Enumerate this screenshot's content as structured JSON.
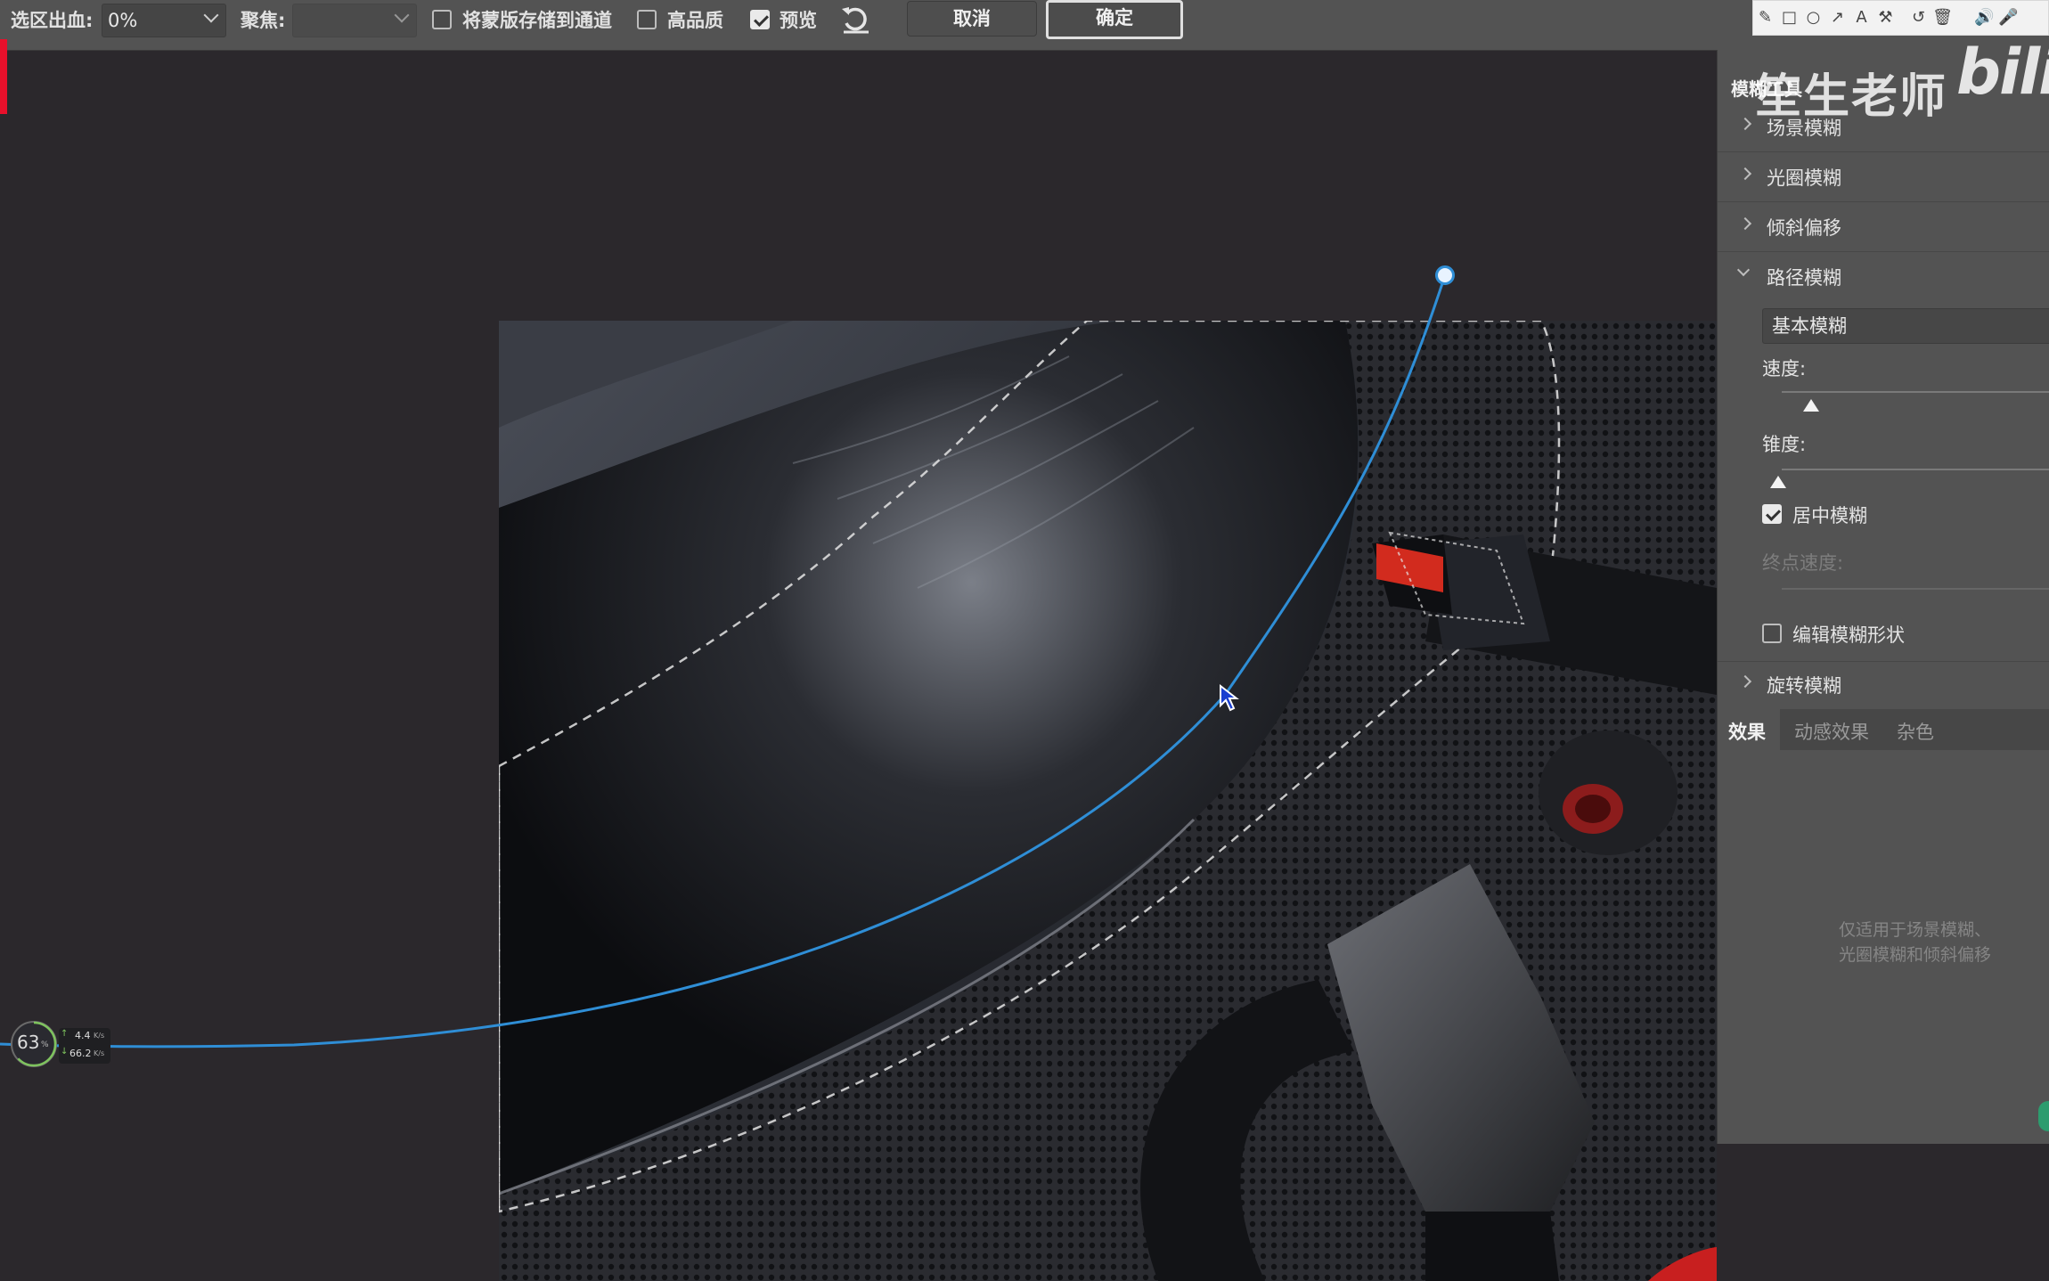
{
  "options": {
    "feather_label": "选区出血:",
    "feather_value": "0%",
    "focus_label": "聚焦:",
    "focus_value": "",
    "save_mask_label": "将蒙版存储到通道",
    "save_mask_checked": false,
    "hq_label": "高品质",
    "hq_checked": false,
    "preview_label": "预览",
    "preview_checked": true,
    "reset_icon": "reset-arrow-icon",
    "cancel_label": "取消",
    "ok_label": "确定"
  },
  "annot_toolbar": {
    "icons": [
      "pencil-icon",
      "rectangle-icon",
      "ellipse-icon",
      "arrow-icon",
      "text-icon",
      "magic-icon",
      "undo-icon",
      "trash-icon",
      "speaker-icon",
      "mic-icon"
    ]
  },
  "watermark": {
    "author": "笙生老师",
    "logo": "bili"
  },
  "panel": {
    "title": "模糊工具",
    "sections": [
      {
        "label": "场景模糊",
        "expanded": false
      },
      {
        "label": "光圈模糊",
        "expanded": false
      },
      {
        "label": "倾斜偏移",
        "expanded": false
      },
      {
        "label": "路径模糊",
        "expanded": true
      },
      {
        "label": "旋转模糊",
        "expanded": false
      }
    ],
    "path_blur": {
      "type_value": "基本模糊",
      "speed_label": "速度:",
      "speed_level": 0.12,
      "taper_label": "锥度:",
      "taper_level": 0.0,
      "center_blur_label": "居中模糊",
      "center_blur_checked": true,
      "end_speed_label": "终点速度:",
      "edit_shape_label": "编辑模糊形状",
      "edit_shape_checked": false
    },
    "tabs": [
      "效果",
      "动感效果",
      "杂色"
    ],
    "active_tab": "效果",
    "hint_line1": "仅适用于场景模糊、",
    "hint_line2": "光圈模糊和倾斜偏移"
  },
  "net_meter": {
    "percent": "63",
    "percent_unit": "%",
    "up": "4.4",
    "up_unit": "K/s",
    "down": "66.2",
    "down_unit": "K/s"
  }
}
